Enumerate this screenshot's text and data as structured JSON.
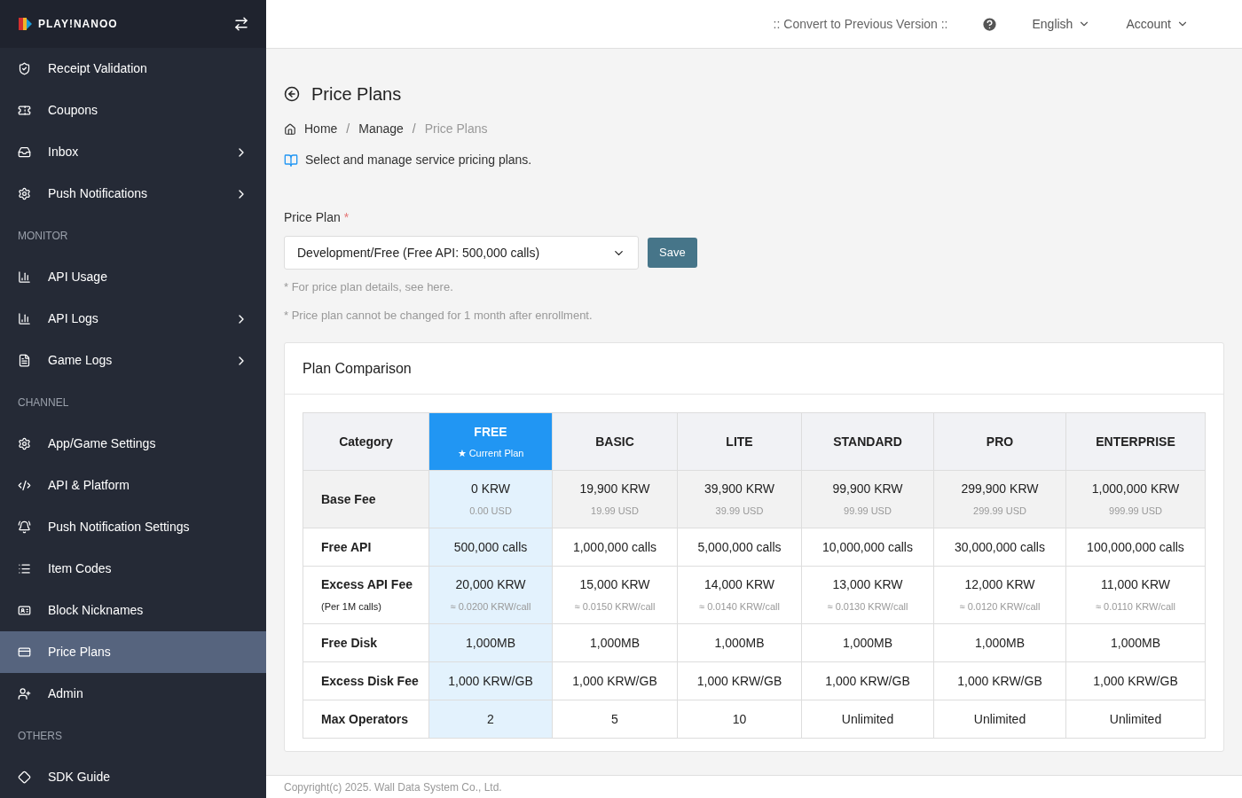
{
  "logo": {
    "text": "PLAY!NANOO"
  },
  "sidebar": {
    "items": [
      {
        "kind": "item",
        "label": "Receipt Validation",
        "has_submenu": false,
        "selected": false
      },
      {
        "kind": "item",
        "label": "Coupons",
        "has_submenu": false,
        "selected": false
      },
      {
        "kind": "item",
        "label": "Inbox",
        "has_submenu": true,
        "selected": false
      },
      {
        "kind": "item",
        "label": "Push Notifications",
        "has_submenu": true,
        "selected": false
      },
      {
        "kind": "section",
        "label": "MONITOR"
      },
      {
        "kind": "item",
        "label": "API Usage",
        "has_submenu": false,
        "selected": false
      },
      {
        "kind": "item",
        "label": "API Logs",
        "has_submenu": true,
        "selected": false
      },
      {
        "kind": "item",
        "label": "Game Logs",
        "has_submenu": true,
        "selected": false
      },
      {
        "kind": "section",
        "label": "CHANNEL"
      },
      {
        "kind": "item",
        "label": "App/Game Settings",
        "has_submenu": false,
        "selected": false
      },
      {
        "kind": "item",
        "label": "API & Platform",
        "has_submenu": false,
        "selected": false
      },
      {
        "kind": "item",
        "label": "Push Notification Settings",
        "has_submenu": false,
        "selected": false
      },
      {
        "kind": "item",
        "label": "Item Codes",
        "has_submenu": false,
        "selected": false
      },
      {
        "kind": "item",
        "label": "Block Nicknames",
        "has_submenu": false,
        "selected": false
      },
      {
        "kind": "item",
        "label": "Price Plans",
        "has_submenu": false,
        "selected": true
      },
      {
        "kind": "item",
        "label": "Admin",
        "has_submenu": false,
        "selected": false
      },
      {
        "kind": "section",
        "label": "OTHERS"
      },
      {
        "kind": "item",
        "label": "SDK Guide",
        "has_submenu": false,
        "selected": false
      }
    ]
  },
  "topbar": {
    "convert_link": ":: Convert to Previous Version ::",
    "language": "English",
    "account": "Account"
  },
  "page": {
    "title": "Price Plans",
    "breadcrumb": [
      "Home",
      "Manage",
      "Price Plans"
    ],
    "breadcrumb_separator": "/",
    "description": "Select and manage service pricing plans."
  },
  "form": {
    "label": "Price Plan",
    "required_mark": "*",
    "select_value": "Development/Free (Free API: 500,000 calls)",
    "save_button": "Save",
    "notes": [
      "* For price plan details, see here.",
      "* Price plan cannot be changed for 1 month after enrollment."
    ]
  },
  "comparison": {
    "title": "Plan Comparison",
    "category_heading": "Category",
    "current_badge": "★ Current Plan",
    "plans": [
      {
        "name": "FREE",
        "current": true
      },
      {
        "name": "BASIC",
        "current": false
      },
      {
        "name": "LITE",
        "current": false
      },
      {
        "name": "STANDARD",
        "current": false
      },
      {
        "name": "PRO",
        "current": false
      },
      {
        "name": "ENTERPRISE",
        "current": false
      }
    ],
    "rows": [
      {
        "label": "Base Fee",
        "shaded": true,
        "cells": [
          {
            "main": "0 KRW",
            "sub": "0.00 USD"
          },
          {
            "main": "19,900 KRW",
            "sub": "19.99 USD"
          },
          {
            "main": "39,900 KRW",
            "sub": "39.99 USD"
          },
          {
            "main": "99,900 KRW",
            "sub": "99.99 USD"
          },
          {
            "main": "299,900 KRW",
            "sub": "299.99 USD"
          },
          {
            "main": "1,000,000 KRW",
            "sub": "999.99 USD"
          }
        ]
      },
      {
        "label": "Free API",
        "shaded": false,
        "cells": [
          {
            "main": "500,000 calls"
          },
          {
            "main": "1,000,000 calls"
          },
          {
            "main": "5,000,000 calls"
          },
          {
            "main": "10,000,000 calls"
          },
          {
            "main": "30,000,000 calls"
          },
          {
            "main": "100,000,000 calls"
          }
        ]
      },
      {
        "label": "Excess API Fee",
        "sublabel": "(Per 1M calls)",
        "shaded": false,
        "cells": [
          {
            "main": "20,000 KRW",
            "sub": "≈ 0.0200 KRW/call"
          },
          {
            "main": "15,000 KRW",
            "sub": "≈ 0.0150 KRW/call"
          },
          {
            "main": "14,000 KRW",
            "sub": "≈ 0.0140 KRW/call"
          },
          {
            "main": "13,000 KRW",
            "sub": "≈ 0.0130 KRW/call"
          },
          {
            "main": "12,000 KRW",
            "sub": "≈ 0.0120 KRW/call"
          },
          {
            "main": "11,000 KRW",
            "sub": "≈ 0.0110 KRW/call"
          }
        ]
      },
      {
        "label": "Free Disk",
        "shaded": false,
        "cells": [
          {
            "main": "1,000MB"
          },
          {
            "main": "1,000MB"
          },
          {
            "main": "1,000MB"
          },
          {
            "main": "1,000MB"
          },
          {
            "main": "1,000MB"
          },
          {
            "main": "1,000MB"
          }
        ]
      },
      {
        "label": "Excess Disk Fee",
        "shaded": false,
        "cells": [
          {
            "main": "1,000 KRW/GB"
          },
          {
            "main": "1,000 KRW/GB"
          },
          {
            "main": "1,000 KRW/GB"
          },
          {
            "main": "1,000 KRW/GB"
          },
          {
            "main": "1,000 KRW/GB"
          },
          {
            "main": "1,000 KRW/GB"
          }
        ]
      },
      {
        "label": "Max Operators",
        "shaded": false,
        "cells": [
          {
            "main": "2"
          },
          {
            "main": "5"
          },
          {
            "main": "10"
          },
          {
            "main": "Unlimited"
          },
          {
            "main": "Unlimited"
          },
          {
            "main": "Unlimited"
          }
        ]
      }
    ]
  },
  "footer": {
    "copyright": "Copyright(c) 2025. Wall Data System Co., Ltd."
  }
}
